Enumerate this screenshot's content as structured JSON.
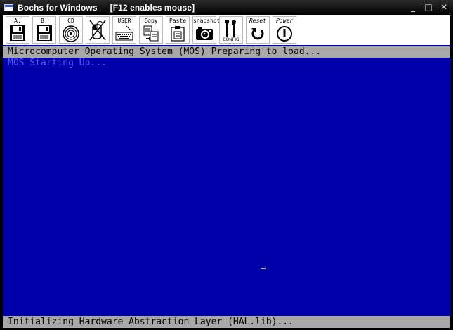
{
  "window": {
    "title": "Bochs for Windows",
    "subtitle": "[F12 enables mouse]",
    "minimize_glyph": "_",
    "maximize_glyph": "□",
    "close_glyph": "✕"
  },
  "toolbar": {
    "buttons": [
      {
        "label": "A:",
        "icon": "floppy-a-icon"
      },
      {
        "label": "B:",
        "icon": "floppy-b-icon"
      },
      {
        "label": "CD",
        "icon": "cdrom-icon"
      },
      {
        "label": "",
        "icon": "mouse-disabled-icon"
      },
      {
        "label": "USER",
        "icon": "keyboard-icon"
      },
      {
        "label": "Copy",
        "icon": "copy-icon"
      },
      {
        "label": "Paste",
        "icon": "paste-icon"
      },
      {
        "label": "snapshot",
        "icon": "camera-icon"
      },
      {
        "label": "CONFIG",
        "icon": "config-tools-icon"
      },
      {
        "label": "Reset",
        "icon": "reset-icon"
      },
      {
        "label": "Power",
        "icon": "power-icon"
      }
    ]
  },
  "console": {
    "header_line": "Microcomputer Operating System (MOS) Preparing to load...",
    "message": "MOS Starting Up...",
    "footer_line": "Initializing Hardware Abstraction Layer (HAL.lib)...",
    "background_color": "#0000a8",
    "bar_color": "#a8a8a8",
    "message_color": "#5757ff"
  }
}
